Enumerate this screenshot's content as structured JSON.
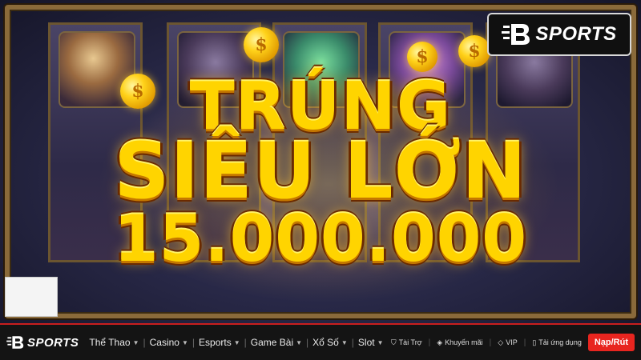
{
  "banner": {
    "line1": "TRÚNG",
    "line2": "SIÊU LỚN",
    "amount": "15.000.000",
    "coin_symbol": "$"
  },
  "brand": {
    "name": "SPORTS",
    "logo_icon": "b-logo-icon"
  },
  "nav": {
    "logo_text": "SPORTS",
    "menu": [
      {
        "label": "Thể Thao"
      },
      {
        "label": "Casino"
      },
      {
        "label": "Esports"
      },
      {
        "label": "Game Bài"
      },
      {
        "label": "Xổ Số"
      },
      {
        "label": "Slot"
      }
    ],
    "utilities": [
      {
        "label": "Tài Trợ",
        "icon": "sponsor-icon"
      },
      {
        "label": "Khuyến mãi",
        "icon": "promo-tag-icon"
      },
      {
        "label": "VIP",
        "icon": "vip-diamond-icon"
      },
      {
        "label": "Tải ứng dụng",
        "icon": "mobile-app-icon"
      }
    ],
    "cta": "Nạp/Rút"
  },
  "colors": {
    "accent": "#e8251f",
    "gold": "#ffd400",
    "nav_bg": "#141414"
  }
}
